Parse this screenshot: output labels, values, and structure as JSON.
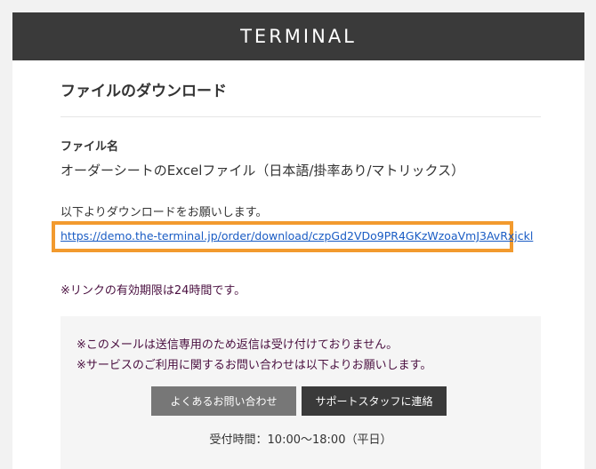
{
  "header": {
    "logo_text": "TERMINAL"
  },
  "main": {
    "title": "ファイルのダウンロード",
    "file_label": "ファイル名",
    "file_name": "オーダーシートのExcelファイル（日本語/掛率あり/マトリックス）",
    "instruction": "以下よりダウンロードをお願いします。",
    "download_link": "https://demo.the-terminal.jp/order/download/czpGd2VDo9PR4GKzWzoaVmJ3AvRxjckl",
    "expiry_note": "※リンクの有効期限は24時間です。"
  },
  "notice": {
    "line1": "※このメールは送信専用のため返信は受け付けておりません。",
    "line2": "※サービスのご利用に関するお問い合わせは以下よりお願いします。",
    "faq_button": "よくあるお問い合わせ",
    "support_button": "サポートスタッフに連絡",
    "hours": "受付時間：10:00〜18:00（平日）"
  },
  "colors": {
    "header_bg": "#3a3a3a",
    "highlight": "#f29a2e",
    "link": "#1a5cc4",
    "note_text": "#4a1040"
  }
}
